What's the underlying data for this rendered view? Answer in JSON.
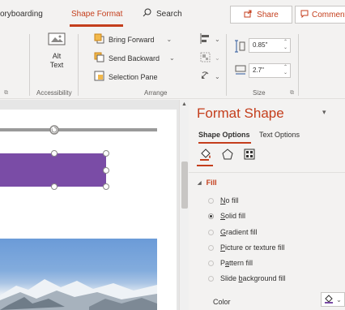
{
  "tabs": {
    "storyboarding": "oryboarding",
    "shape_format": "Shape Format",
    "search_placeholder": "Search",
    "share_label": "Share",
    "comments_label": "Comments"
  },
  "ribbon": {
    "alt_text_line1": "Alt",
    "alt_text_line2": "Text",
    "accessibility_label": "Accessibility",
    "bring_forward": "Bring Forward",
    "send_backward": "Send Backward",
    "selection_pane": "Selection Pane",
    "arrange_label": "Arrange",
    "height_value": "0.85\"",
    "width_value": "2.7\"",
    "size_label": "Size"
  },
  "pane": {
    "title": "Format Shape",
    "shape_options_tab": "Shape Options",
    "text_options_tab": "Text Options",
    "fill_heading": "Fill",
    "options": [
      {
        "pre": "",
        "key": "N",
        "post": "o fill",
        "selected": false,
        "enabled": true
      },
      {
        "pre": "",
        "key": "S",
        "post": "olid fill",
        "selected": true,
        "enabled": true
      },
      {
        "pre": "",
        "key": "G",
        "post": "radient fill",
        "selected": false,
        "enabled": true
      },
      {
        "pre": "",
        "key": "P",
        "post": "icture or texture fill",
        "selected": false,
        "enabled": true
      },
      {
        "pre": "P",
        "key": "a",
        "post": "ttern fill",
        "selected": false,
        "enabled": true
      },
      {
        "pre": "Slide ",
        "key": "b",
        "post": "ackground fill",
        "selected": false,
        "enabled": true
      }
    ],
    "color_label": "Color",
    "fill_color": "#7a4ca6"
  },
  "colors": {
    "accent": "#c43e1c",
    "shape_fill": "#7a4ca6"
  }
}
